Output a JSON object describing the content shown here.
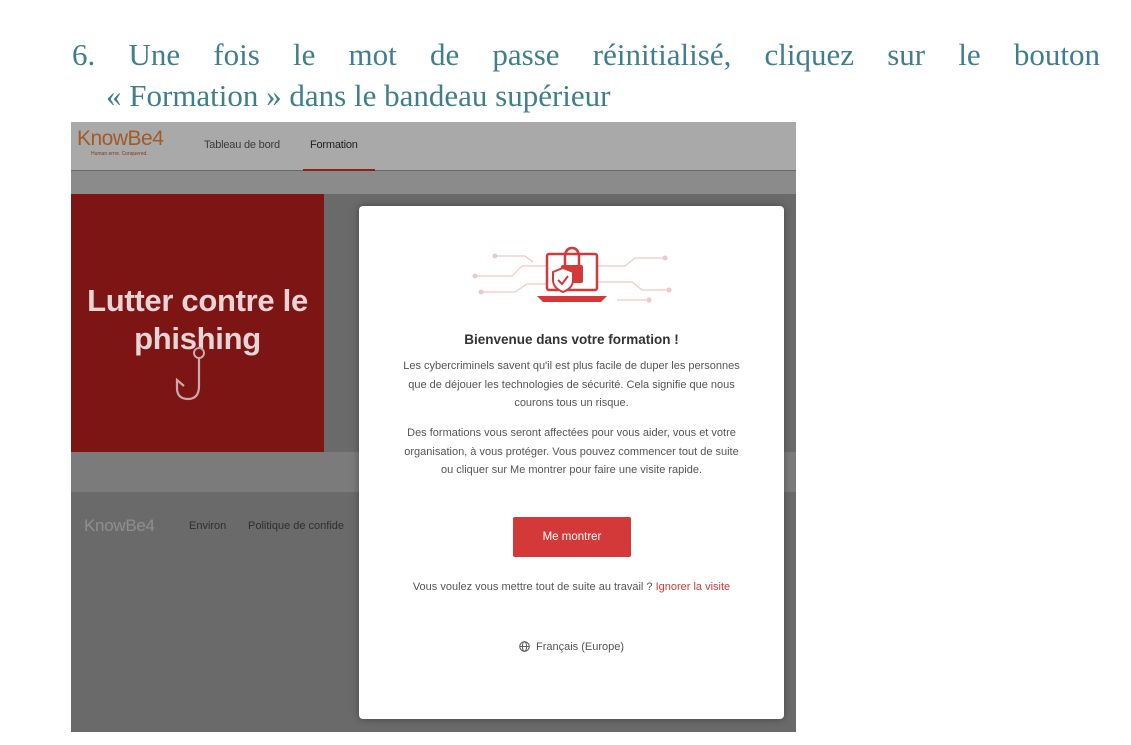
{
  "instruction": {
    "step_words": [
      "6.",
      "Une",
      "fois",
      "le",
      "mot",
      "de",
      "passe",
      "réinitialisé,",
      "cliquez",
      "sur",
      "le",
      "bouton"
    ],
    "line2": "« Formation » dans le bandeau supérieur"
  },
  "app": {
    "logo": "KnowBe4",
    "tagline": "Human error. Conquered.",
    "nav": {
      "dashboard": "Tableau de bord",
      "training": "Formation"
    }
  },
  "banner": {
    "title": "Lutter contre le phishing"
  },
  "footer": {
    "logo": "KnowBe4",
    "links": [
      "Environ",
      "Politique de confide"
    ]
  },
  "modal": {
    "title": "Bienvenue dans votre formation !",
    "paragraph1": "Les cybercriminels savent qu'il est plus facile de duper les personnes que de déjouer les technologies de sécurité. Cela signifie que nous courons tous un risque.",
    "paragraph2": "Des formations vous seront affectées pour vous aider, vous et votre organisation, à vous protéger. Vous pouvez commencer tout de suite ou cliquer sur Me montrer pour faire une visite rapide.",
    "show_button": "Me montrer",
    "skip_text": "Vous voulez vous mettre tout de suite au travail ?",
    "skip_link": "Ignorer la visite",
    "language": "Français (Europe)"
  },
  "colors": {
    "brand_red": "#d43939",
    "banner_red": "#7d1515",
    "instruction_teal": "#3f7f8c",
    "logo_orange": "#a35a24"
  }
}
